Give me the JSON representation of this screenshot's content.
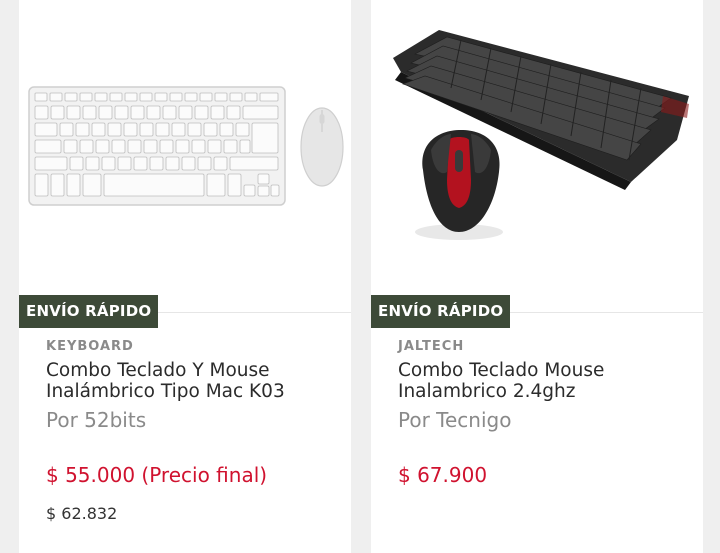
{
  "products": [
    {
      "badge": "ENVÍO RÁPIDO",
      "brand": "KEYBOARD",
      "title": "Combo Teclado Y Mouse Inalámbrico Tipo Mac K03",
      "seller": "Por 52bits",
      "price": "$ 55.000 (Precio final)",
      "old_price": "$ 62.832",
      "image_icon": "white-keyboard-mouse-image"
    },
    {
      "badge": "ENVÍO RÁPIDO",
      "brand": "JALTECH",
      "title": "Combo Teclado Mouse Inalambrico 2.4ghz",
      "seller": "Por Tecnigo",
      "price": "$ 67.900",
      "image_icon": "black-keyboard-mouse-image"
    }
  ],
  "colors": {
    "badge_bg": "#3d4a38",
    "price": "#d0122f",
    "muted": "#8a8a8a"
  }
}
